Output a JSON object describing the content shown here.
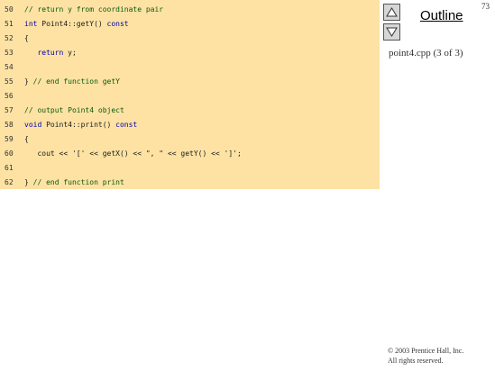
{
  "slide": {
    "number": "73"
  },
  "nav": {
    "up_icon": "up-triangle-icon",
    "down_icon": "down-triangle-icon",
    "outline_label": "Outline",
    "file_caption": "point4.cpp (3 of 3)"
  },
  "code": {
    "lines": [
      {
        "num": "50",
        "segments": [
          {
            "text": "// return y from coordinate pair",
            "cls": "comment"
          }
        ]
      },
      {
        "num": "51",
        "segments": [
          {
            "text": "int",
            "cls": "keyword"
          },
          {
            "text": " Point4::getY() ",
            "cls": "plain"
          },
          {
            "text": "const",
            "cls": "keyword"
          }
        ]
      },
      {
        "num": "52",
        "segments": [
          {
            "text": "{",
            "cls": "plain"
          }
        ]
      },
      {
        "num": "53",
        "segments": [
          {
            "text": "   ",
            "cls": "plain"
          },
          {
            "text": "return",
            "cls": "keyword"
          },
          {
            "text": " y;",
            "cls": "plain"
          }
        ]
      },
      {
        "num": "54",
        "segments": []
      },
      {
        "num": "55",
        "segments": [
          {
            "text": "} ",
            "cls": "plain"
          },
          {
            "text": "// end function getY",
            "cls": "comment"
          }
        ]
      },
      {
        "num": "56",
        "segments": []
      },
      {
        "num": "57",
        "segments": [
          {
            "text": "// output Point4 object",
            "cls": "comment"
          }
        ]
      },
      {
        "num": "58",
        "segments": [
          {
            "text": "void",
            "cls": "keyword"
          },
          {
            "text": " Point4::print() ",
            "cls": "plain"
          },
          {
            "text": "const",
            "cls": "keyword"
          }
        ]
      },
      {
        "num": "59",
        "segments": [
          {
            "text": "{",
            "cls": "plain"
          }
        ]
      },
      {
        "num": "60",
        "segments": [
          {
            "text": "   cout << '[' << getX() << \", \" << getY() << ']';",
            "cls": "plain"
          }
        ]
      },
      {
        "num": "61",
        "segments": []
      },
      {
        "num": "62",
        "segments": [
          {
            "text": "} ",
            "cls": "plain"
          },
          {
            "text": "// end function print",
            "cls": "comment"
          }
        ]
      }
    ]
  },
  "footer": {
    "line1": "© 2003 Prentice Hall, Inc.",
    "line2": "All rights reserved."
  },
  "colors": {
    "code_background": "#fde2a4",
    "comment": "#0a5a0a",
    "keyword": "#0000aa"
  }
}
